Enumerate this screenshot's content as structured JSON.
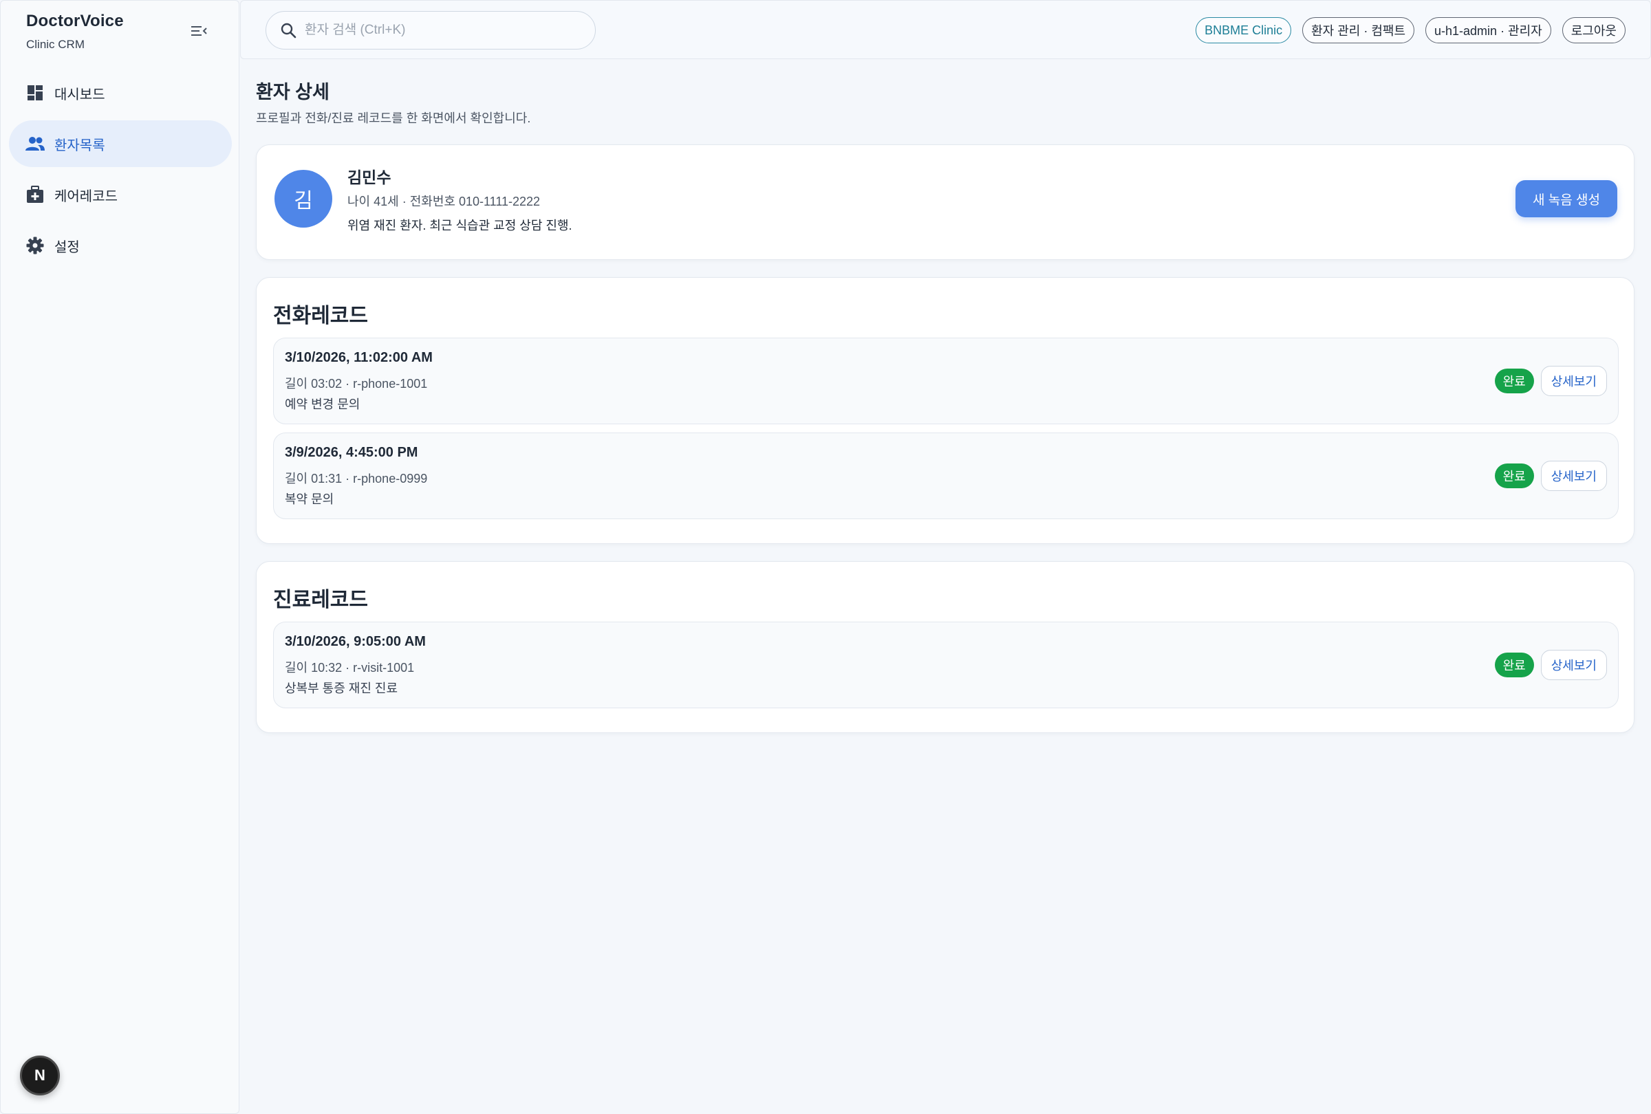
{
  "sidebar": {
    "brand_name": "DoctorVoice",
    "brand_sub": "Clinic CRM",
    "items": [
      {
        "label": "대시보드",
        "icon": "dashboard-icon",
        "active": false
      },
      {
        "label": "환자목록",
        "icon": "people-icon",
        "active": true
      },
      {
        "label": "케어레코드",
        "icon": "medical-bag-icon",
        "active": false
      },
      {
        "label": "설정",
        "icon": "gear-icon",
        "active": false
      }
    ],
    "bottom_badge": "N"
  },
  "header": {
    "search_placeholder": "환자 검색 (Ctrl+K)",
    "chips": {
      "clinic": "BNBME Clinic",
      "mode": "환자 관리 · 컴팩트",
      "user": "u-h1-admin · 관리자",
      "logout": "로그아웃"
    }
  },
  "page": {
    "title": "환자 상세",
    "subtitle": "프로필과 전화/진료 레코드를 한 화면에서 확인합니다."
  },
  "patient": {
    "avatar_initial": "김",
    "name": "김민수",
    "meta": "나이 41세 · 전화번호 010-1111-2222",
    "note": "위염 재진 환자. 최근 식습관 교정 상담 진행.",
    "new_recording_label": "새 녹음 생성"
  },
  "phone_records": {
    "title": "전화레코드",
    "items": [
      {
        "time": "3/10/2026, 11:02:00 AM",
        "meta": "길이 03:02 · r-phone-1001",
        "desc": "예약 변경 문의",
        "status": "완료",
        "detail_label": "상세보기"
      },
      {
        "time": "3/9/2026, 4:45:00 PM",
        "meta": "길이 01:31 · r-phone-0999",
        "desc": "복약 문의",
        "status": "완료",
        "detail_label": "상세보기"
      }
    ]
  },
  "visit_records": {
    "title": "진료레코드",
    "items": [
      {
        "time": "3/10/2026, 9:05:00 AM",
        "meta": "길이 10:32 · r-visit-1001",
        "desc": "상복부 통증 재진 진료",
        "status": "완료",
        "detail_label": "상세보기"
      }
    ]
  },
  "colors": {
    "accent": "#4f86e8",
    "active_nav_bg": "#e6eefb",
    "status_done": "#16a34a",
    "clinic_chip": "#1d7e96"
  }
}
